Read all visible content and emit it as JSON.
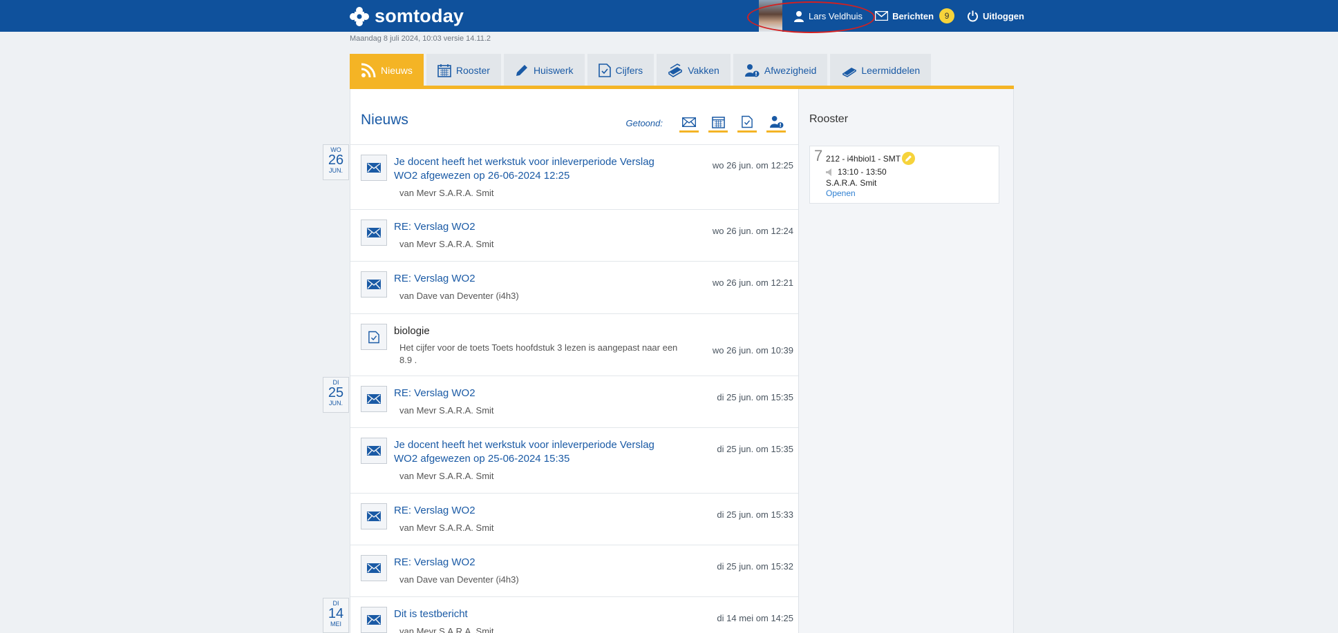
{
  "header": {
    "logo_text": "somtoday",
    "user_name": "Lars Veldhuis",
    "messages_label": "Berichten",
    "messages_count": "9",
    "logout_label": "Uitloggen"
  },
  "date_line": "Maandag 8 juli 2024, 10:03 versie 14.11.2",
  "tabs": [
    {
      "label": "Nieuws",
      "icon": "rss-icon",
      "active": true
    },
    {
      "label": "Rooster",
      "icon": "calendar-icon"
    },
    {
      "label": "Huiswerk",
      "icon": "pencil-icon"
    },
    {
      "label": "Cijfers",
      "icon": "grade-doc-icon"
    },
    {
      "label": "Vakken",
      "icon": "books-icon"
    },
    {
      "label": "Afwezigheid",
      "icon": "user-alert-icon"
    },
    {
      "label": "Leermiddelen",
      "icon": "book-icon"
    }
  ],
  "news": {
    "title": "Nieuws",
    "filter_label": "Getoond:",
    "filter_icons": [
      "envelope-icon",
      "calendar-icon",
      "grade-doc-icon",
      "user-alert-icon"
    ],
    "day_tags": [
      {
        "weekday": "WO",
        "day": "26",
        "month": "JUN."
      },
      {
        "weekday": "DI",
        "day": "25",
        "month": "JUN."
      },
      {
        "weekday": "DI",
        "day": "14",
        "month": "MEI"
      }
    ],
    "items": [
      {
        "icon": "envelope-icon",
        "title": "Je docent heeft het werkstuk voor inleverperiode Verslag WO2 afgewezen op 26-06-2024 12:25",
        "sub": "van Mevr S.A.R.A. Smit",
        "time": "wo 26 jun. om 12:25"
      },
      {
        "icon": "envelope-icon",
        "title": "RE: Verslag WO2",
        "sub": "van Mevr S.A.R.A. Smit",
        "time": "wo 26 jun. om 12:24"
      },
      {
        "icon": "envelope-icon",
        "title": "RE: Verslag WO2",
        "sub": "van Dave van Deventer (i4h3)",
        "time": "wo 26 jun. om 12:21"
      },
      {
        "icon": "grade-doc-icon",
        "title": "biologie",
        "sub": "Het cijfer voor de toets Toets hoofdstuk 3 lezen is aangepast naar een 8.9 .",
        "time": "wo 26 jun. om 10:39"
      },
      {
        "icon": "envelope-icon",
        "title": "RE: Verslag WO2",
        "sub": "van Mevr S.A.R.A. Smit",
        "time": "di 25 jun. om 15:35"
      },
      {
        "icon": "envelope-icon",
        "title": "Je docent heeft het werkstuk voor inleverperiode Verslag WO2 afgewezen op 25-06-2024 15:35",
        "sub": "van Mevr S.A.R.A. Smit",
        "time": "di 25 jun. om 15:35"
      },
      {
        "icon": "envelope-icon",
        "title": "RE: Verslag WO2",
        "sub": "van Mevr S.A.R.A. Smit",
        "time": "di 25 jun. om 15:33"
      },
      {
        "icon": "envelope-icon",
        "title": "RE: Verslag WO2",
        "sub": "van Dave van Deventer (i4h3)",
        "time": "di 25 jun. om 15:32"
      },
      {
        "icon": "envelope-icon",
        "title": "Dit is testbericht",
        "sub": "van Mevr S.A.R.A. Smit",
        "time": "di 14 mei om 14:25"
      }
    ]
  },
  "rooster": {
    "title": "Rooster",
    "hour": "7",
    "lesson": "212 - i4hbiol1 - SMT",
    "time": "13:10 - 13:50",
    "teacher": "S.A.R.A. Smit",
    "open_label": "Openen"
  },
  "colors": {
    "header_blue": "#0f519c",
    "accent_yellow": "#f4b425",
    "link_blue": "#1a5aa5"
  }
}
